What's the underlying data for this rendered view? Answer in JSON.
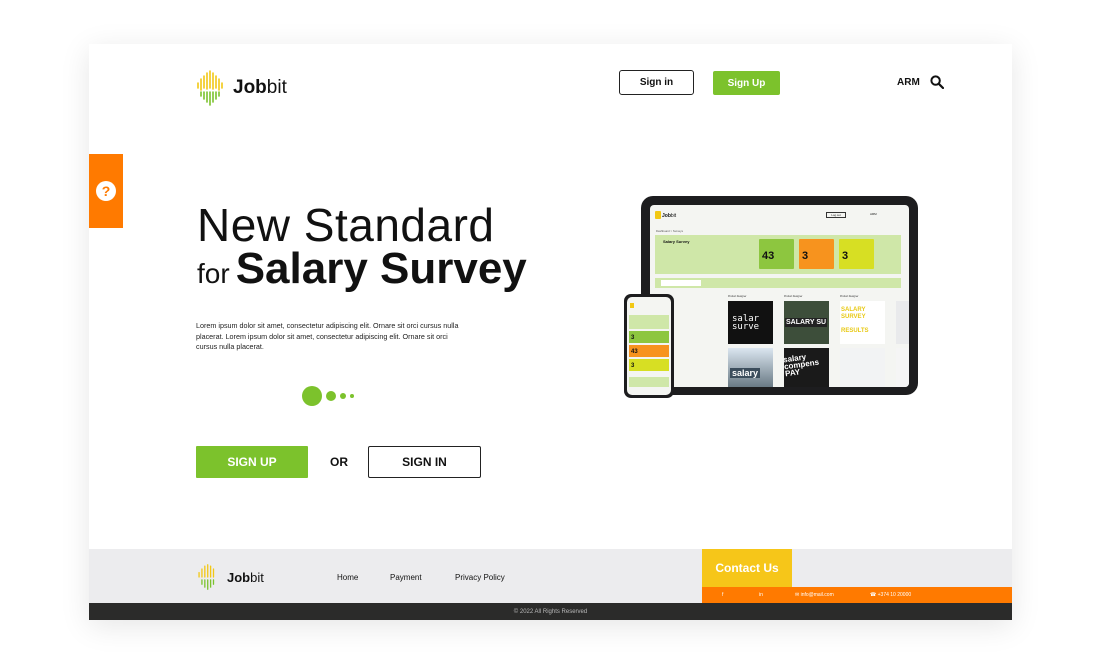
{
  "header": {
    "logo_bold": "Job",
    "logo_light": "bit",
    "signin_label": "Sign in",
    "signup_label": "Sign Up",
    "language": "ARM"
  },
  "help": {
    "icon": "question-icon",
    "label": "?"
  },
  "hero": {
    "title_line1": "New Standard",
    "title_for": "for",
    "title_bold": "Salary Survey",
    "description": "Lorem ipsum dolor sit amet, consectetur adipiscing elit. Ornare sit orci cursus nulla placerat. Lorem ipsum dolor sit amet, consectetur adipiscing elit. Ornare sit orci cursus nulla placerat.",
    "cta_signup": "SIGN UP",
    "or_label": "OR",
    "cta_signin": "SIGN IN"
  },
  "mockup": {
    "logo_bold": "Job",
    "logo_light": "bit",
    "login": "Log out",
    "lang": "ARM",
    "breadcrumb": "Dashboard  >  Surveys",
    "banner_title": "Salary Survey",
    "cards": [
      {
        "value": "43",
        "color": "#8dc63f"
      },
      {
        "value": "3",
        "color": "#f7931e"
      },
      {
        "value": "3",
        "color": "#d7df23"
      }
    ],
    "phone_cards": [
      {
        "value": "3",
        "color": "#8dc63f"
      },
      {
        "value": "43",
        "color": "#f7931e"
      },
      {
        "value": "3",
        "color": "#d7df23"
      }
    ],
    "image_texts": [
      "Salary Survey",
      "SALARY SU",
      "SALARY SURVEY RESULTS",
      "salary"
    ]
  },
  "footer": {
    "logo_bold": "Job",
    "logo_light": "bit",
    "links": [
      "Home",
      "Payment",
      "Privacy Policy"
    ],
    "contact_label": "Contact Us",
    "social_facebook": "f",
    "social_linkedin": "in",
    "email": "info@mail.com",
    "phone": "+374 10 20000",
    "copyright": "© 2022 All Rights Reserved"
  },
  "colors": {
    "green": "#7cc22c",
    "orange": "#ff7a00",
    "yellow": "#f6c619",
    "dark": "#2b2b2a"
  }
}
